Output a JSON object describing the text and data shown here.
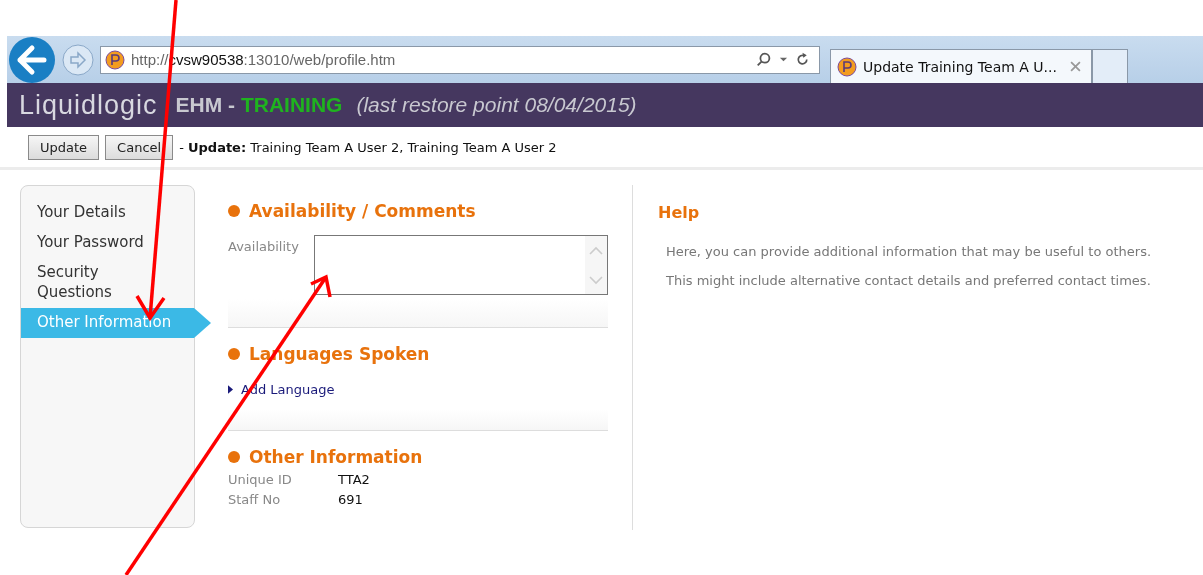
{
  "browser": {
    "url": {
      "scheme": "http://",
      "host": "cvsw90538",
      "path": ":13010/web/profile.htm"
    },
    "tab_title": "Update Training Team A U..."
  },
  "header": {
    "logo": "Liquidlogic",
    "product": "EHM - ",
    "environment": "TRAINING",
    "restore_note": "(last restore point 08/04/2015)"
  },
  "toolbar": {
    "buttons": [
      "Update",
      "Cancel"
    ],
    "status": "- **Update:** Training Team A User 2, Training Team A User 2"
  },
  "sidebar": {
    "items": [
      {
        "label": "Your Details",
        "selected": false
      },
      {
        "label": "Your Password",
        "selected": false
      },
      {
        "label": "Security Questions",
        "selected": false
      },
      {
        "label": "Other Information",
        "selected": true
      }
    ]
  },
  "sections": [
    {
      "kind": "textarea",
      "title": "Availability / Comments",
      "field_label": "Availability"
    },
    {
      "kind": "link",
      "title": "Languages Spoken",
      "link": "Add Language"
    },
    {
      "kind": "fields",
      "title": "Other Information",
      "rows": [
        {
          "label": "Unique ID",
          "value": "TTA2"
        },
        {
          "label": "Staff No",
          "value": "691"
        }
      ]
    }
  ],
  "help": {
    "title": "Help",
    "paragraphs": [
      "Here, you can provide additional information that may be useful to others.",
      "This might include alternative contact details and preferred contact times."
    ]
  }
}
